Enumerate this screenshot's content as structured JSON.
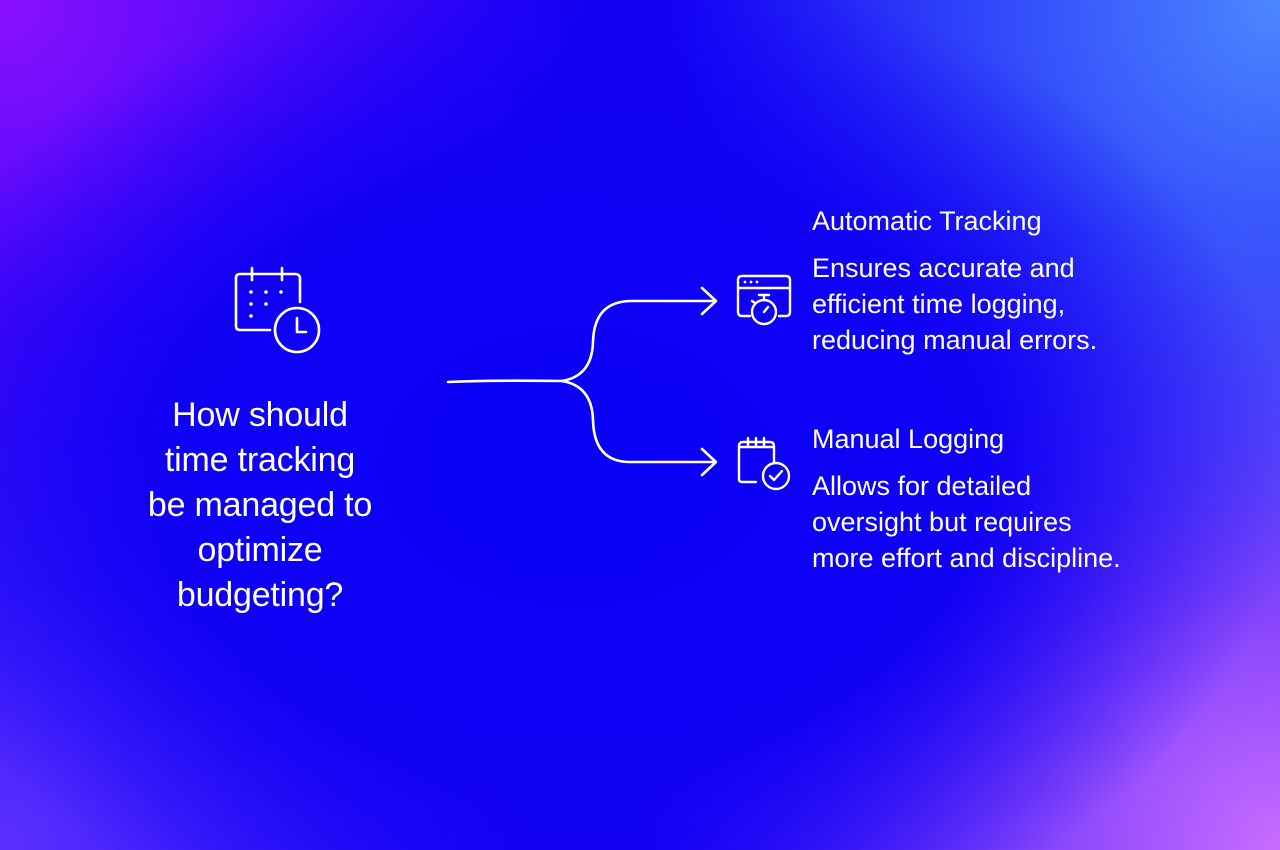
{
  "question": {
    "lines": [
      "How should",
      "time tracking",
      "be managed to",
      "optimize",
      "budgeting?"
    ],
    "icon": "calendar-clock-icon"
  },
  "branches": [
    {
      "title": "Automatic Tracking",
      "description_lines": [
        "Ensures accurate and",
        "efficient time logging,",
        "reducing manual errors."
      ],
      "icon": "browser-stopwatch-icon"
    },
    {
      "title": "Manual Logging",
      "description_lines": [
        "Allows for detailed",
        "oversight but requires",
        "more effort and discipline."
      ],
      "icon": "notepad-check-icon"
    }
  ],
  "colors": {
    "foreground": "#ffffff",
    "background_center": "#0a00f5",
    "corner_top_left": "#8a10ff",
    "corner_top_right": "#4c88ff",
    "corner_bottom_right": "#c86cff",
    "corner_bottom_left": "#5a30ff"
  }
}
